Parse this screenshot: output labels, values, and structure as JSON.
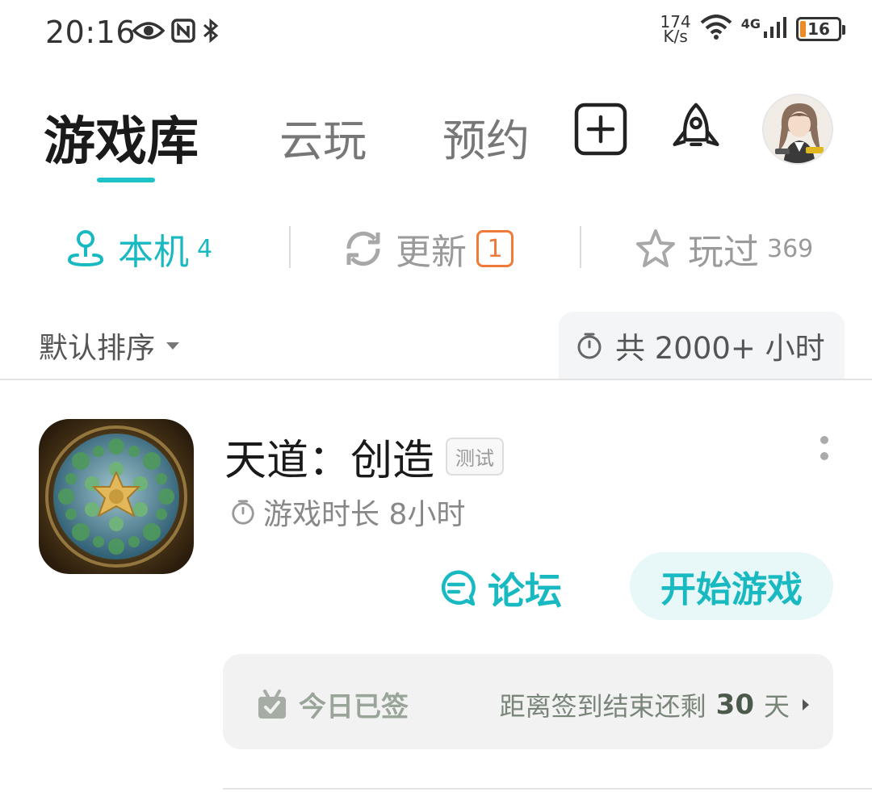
{
  "status_bar": {
    "time": "20:16",
    "net_speed_value": "174",
    "net_speed_unit": "K/s",
    "network_type": "4G",
    "battery_level": "16",
    "icons": [
      "eye-icon",
      "nfc-icon",
      "bluetooth-icon",
      "wifi-icon",
      "signal-icon",
      "battery-icon"
    ]
  },
  "top_tabs": {
    "items": [
      {
        "label": "游戏库",
        "active": true
      },
      {
        "label": "云玩",
        "active": false
      },
      {
        "label": "预约",
        "active": false
      }
    ],
    "actions": [
      "add-icon",
      "rocket-icon",
      "avatar"
    ]
  },
  "sub_tabs": [
    {
      "label": "本机",
      "count": "4",
      "icon": "local-device-icon",
      "active": true
    },
    {
      "label": "更新",
      "badge": "1",
      "icon": "refresh-icon",
      "active": false
    },
    {
      "label": "玩过",
      "count": "369",
      "icon": "star-icon",
      "active": false
    }
  ],
  "sort": {
    "label": "默认排序",
    "total_time": "共 2000+ 小时"
  },
  "game": {
    "title": "天道：创造",
    "tag": "测试",
    "play_time": "游戏时长 8小时",
    "forum_label": "论坛",
    "start_label": "开始游戏",
    "signin_status": "今日已签",
    "signin_prefix": "距离签到结束还剩",
    "signin_days": "30",
    "signin_unit": "天"
  },
  "colors": {
    "accent": "#18b9c0",
    "badge": "#f07a3a"
  }
}
